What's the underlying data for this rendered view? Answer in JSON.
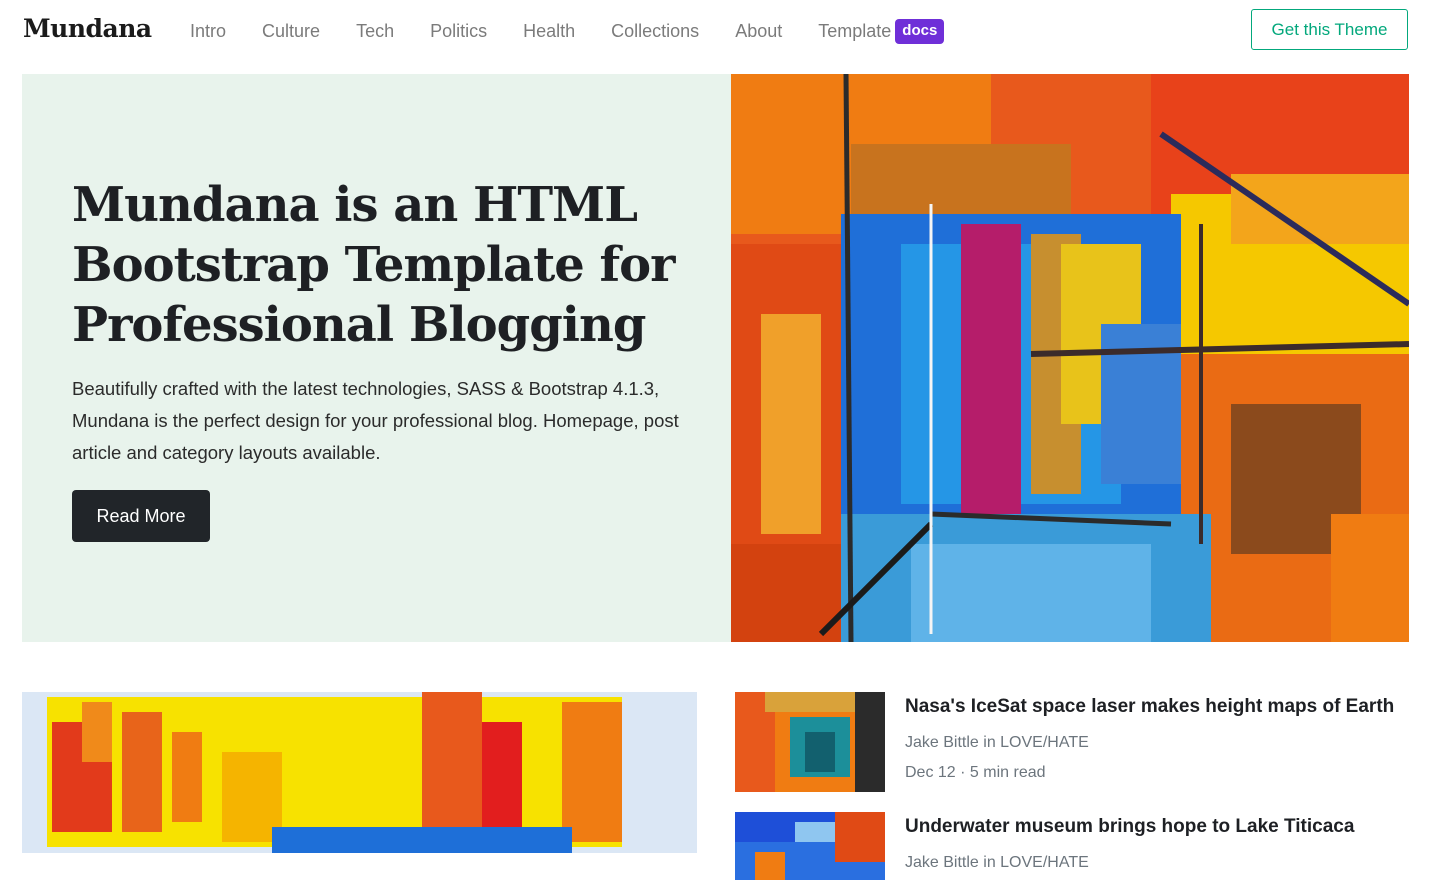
{
  "brand": "Mundana",
  "nav": {
    "items": [
      "Intro",
      "Culture",
      "Tech",
      "Politics",
      "Health",
      "Collections",
      "About"
    ],
    "template_label": "Template",
    "template_badge": "docs",
    "cta": "Get this Theme"
  },
  "hero": {
    "title": "Mundana is an HTML Bootstrap Template for Professional Blogging",
    "description": "Beautifully crafted with the latest technologies, SASS & Bootstrap 4.1.3, Mundana is the perfect design for your professional blog. Homepage, post article and category layouts available.",
    "button": "Read More"
  },
  "posts": [
    {
      "title": "Nasa's IceSat space laser makes height maps of Earth",
      "author": "Jake Bittle in LOVE/HATE",
      "meta": "Dec 12 · 5 min read"
    },
    {
      "title": "Underwater museum brings hope to Lake Titicaca",
      "author": "Jake Bittle in LOVE/HATE"
    }
  ],
  "colors": {
    "accent": "#03a87c",
    "badge": "#6f2fd8",
    "hero_bg": "#e8f3ec",
    "dark": "#212529"
  }
}
